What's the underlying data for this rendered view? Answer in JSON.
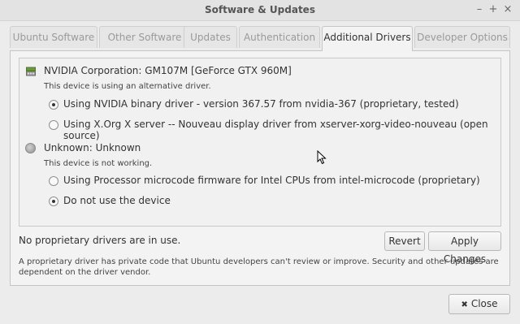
{
  "window": {
    "title": "Software & Updates",
    "minimize_glyph": "–",
    "maximize_glyph": "+",
    "close_glyph": "×"
  },
  "tabs": [
    {
      "label": "Ubuntu Software"
    },
    {
      "label": "Other Software"
    },
    {
      "label": "Updates"
    },
    {
      "label": "Authentication"
    },
    {
      "label": "Additional Drivers"
    },
    {
      "label": "Developer Options"
    }
  ],
  "active_tab": "Additional Drivers",
  "devices": [
    {
      "icon": "graphics-card-icon",
      "name": "NVIDIA Corporation: GM107M [GeForce GTX 960M]",
      "status": "This device is using an alternative driver.",
      "options": [
        {
          "label": "Using NVIDIA binary driver - version 367.57 from nvidia-367 (proprietary, tested)",
          "selected": true
        },
        {
          "label": "Using X.Org X server -- Nouveau display driver from xserver-xorg-video-nouveau (open source)",
          "selected": false
        }
      ]
    },
    {
      "icon": "unknown-device-icon",
      "name": "Unknown: Unknown",
      "status": "This device is not working.",
      "options": [
        {
          "label": "Using Processor microcode firmware for Intel CPUs from intel-microcode (proprietary)",
          "selected": false
        },
        {
          "label": "Do not use the device",
          "selected": true
        }
      ]
    }
  ],
  "status_text": "No proprietary drivers are in use.",
  "buttons": {
    "revert": "Revert",
    "apply": "Apply Changes",
    "close": "Close",
    "close_icon_glyph": "✖"
  },
  "footnote": "A proprietary driver has private code that Ubuntu developers can't review or improve. Security and other updates are dependent on the driver vendor."
}
